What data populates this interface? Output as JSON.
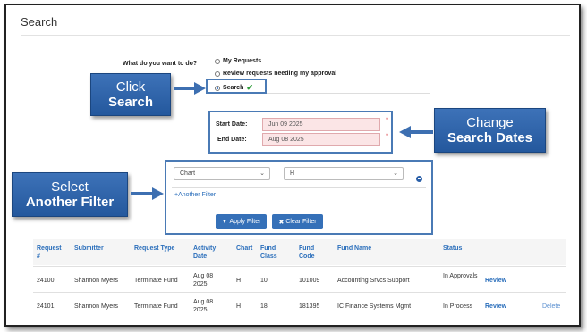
{
  "page": {
    "title": "Search"
  },
  "search_type": {
    "question": "What do you want to do?",
    "options": [
      "My Requests",
      "Review requests needing my approval",
      "Search"
    ],
    "selected": "Search"
  },
  "dates": {
    "start_label": "Start Date:",
    "start_value": "Jun 09 2025",
    "end_label": "End Date:",
    "end_value": "Aug 08 2025"
  },
  "filter": {
    "field_value": "Chart",
    "value_value": "H",
    "add_label": "Another Filter",
    "apply_label": "Apply Filter",
    "clear_label": "Clear Filter"
  },
  "callouts": {
    "click": {
      "line1": "Click",
      "line2": "Search"
    },
    "change": {
      "line1": "Change",
      "line2": "Search Dates"
    },
    "select": {
      "line1": "Select",
      "line2": "Another Filter"
    }
  },
  "table": {
    "headers": [
      "Request #",
      "Submitter",
      "Request Type",
      "Activity Date",
      "Chart",
      "Fund Class",
      "Fund Code",
      "Fund Name",
      "Status"
    ],
    "rows": [
      {
        "request": "24100",
        "submitter": "Shannon Myers",
        "type": "Terminate Fund",
        "date": "Aug 08 2025",
        "chart": "H",
        "fund_class": "10",
        "fund_code": "101009",
        "fund_name": "Accounting Srvcs Support",
        "status": "In Approvals",
        "action": "Review",
        "delete": ""
      },
      {
        "request": "24101",
        "submitter": "Shannon Myers",
        "type": "Terminate Fund",
        "date": "Aug 08 2025",
        "chart": "H",
        "fund_class": "18",
        "fund_code": "181395",
        "fund_name": "IC Finance Systems Mgmt",
        "status": "In Process",
        "action": "Review",
        "delete": "Delete"
      }
    ]
  },
  "colors": {
    "accent": "#3570b8",
    "callout": "#2b62a8",
    "required": "#d9363e",
    "error_bg": "#fbe5e6",
    "link": "#2a6ebb"
  }
}
